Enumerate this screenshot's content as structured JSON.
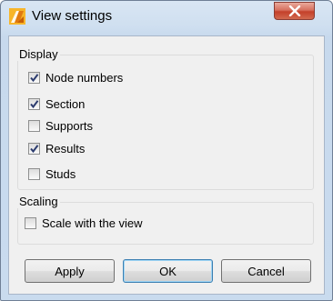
{
  "window": {
    "title": "View settings",
    "app_icon": "app-logo-icon",
    "close_icon": "close-icon"
  },
  "display": {
    "label": "Display",
    "items": [
      {
        "label": "Node numbers",
        "checked": true
      },
      {
        "label": "Section",
        "checked": true
      },
      {
        "label": "Supports",
        "checked": false
      },
      {
        "label": "Results",
        "checked": true
      },
      {
        "label": "Studs",
        "checked": false
      }
    ]
  },
  "scaling": {
    "label": "Scaling",
    "items": [
      {
        "label": "Scale with the view",
        "checked": false
      }
    ]
  },
  "buttons": {
    "apply": "Apply",
    "ok": "OK",
    "cancel": "Cancel"
  },
  "colors": {
    "check_mark": "#2b3b6e",
    "close_button": "#c4402a",
    "logo_orange": "#f39a1e"
  }
}
